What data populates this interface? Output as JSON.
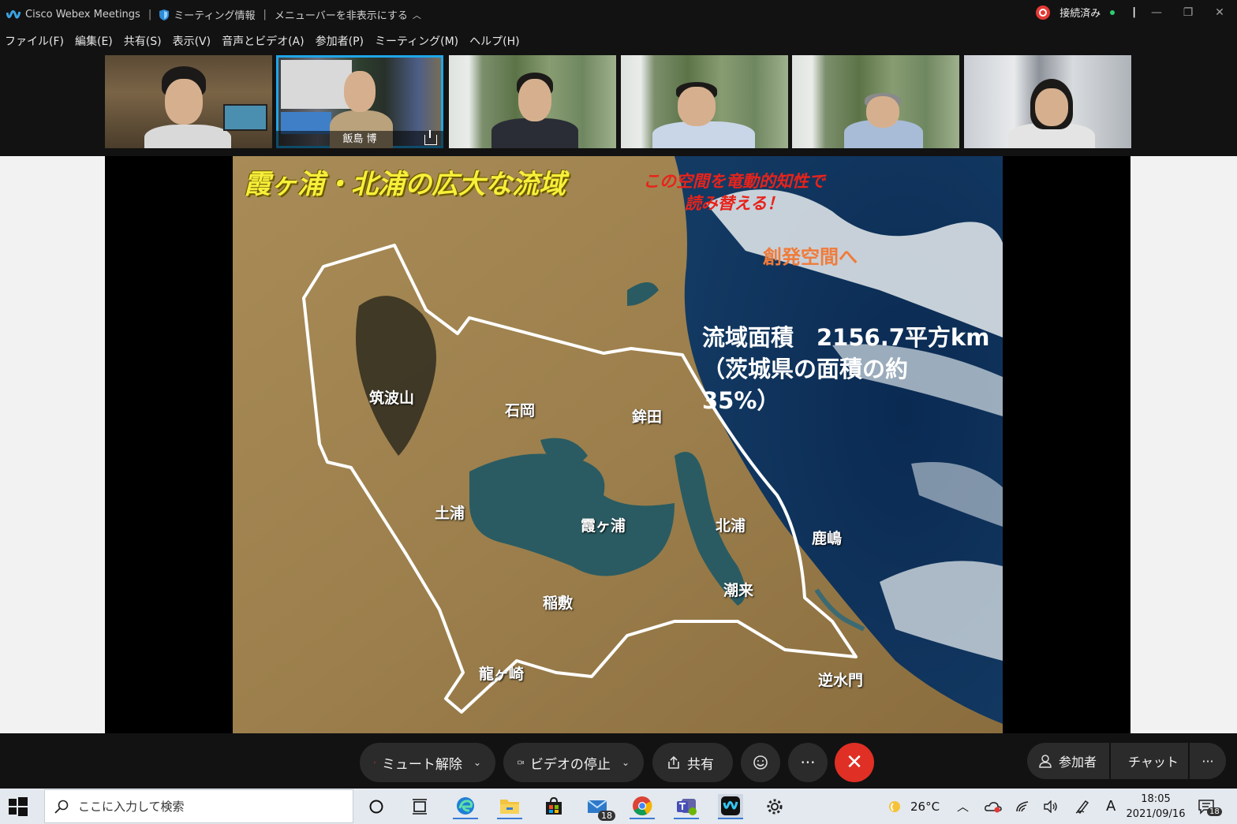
{
  "titlebar": {
    "app_name": "Cisco Webex Meetings",
    "meeting_info": "ミーティング情報",
    "hide_menu": "メニューバーを非表示にする",
    "status": "接続済み"
  },
  "menu": [
    "ファイル(F)",
    "編集(E)",
    "共有(S)",
    "表示(V)",
    "音声とビデオ(A)",
    "参加者(P)",
    "ミーティング(M)",
    "ヘルプ(H)"
  ],
  "participants": [
    {
      "name": "",
      "bg": "room"
    },
    {
      "name": "飯島  博",
      "bg": "study",
      "active": true
    },
    {
      "name": "",
      "bg": "forest"
    },
    {
      "name": "",
      "bg": "forest"
    },
    {
      "name": "",
      "bg": "forest"
    },
    {
      "name": "",
      "bg": "blur"
    }
  ],
  "slide": {
    "title": "霞ヶ浦・北浦の広大な流域",
    "subtitle": "この空間を竜動的知性で\n読み替える！",
    "creation": "創発空間へ",
    "area_text": "流域面積　2156.7平方km\n（茨城県の面積の約\n35%）",
    "places": {
      "tsukuba": "筑波山",
      "ishioka": "石岡",
      "hokota": "鉾田",
      "tsuchiura": "土浦",
      "kasumigaura": "霞ヶ浦",
      "kitaura": "北浦",
      "kashima": "鹿嶋",
      "itako": "潮来",
      "inashiki": "稲敷",
      "ryugasaki": "龍ヶ崎",
      "gyakusuimon": "逆水門"
    }
  },
  "controls": {
    "unmute": "ミュート解除",
    "stop_video": "ビデオの停止",
    "share": "共有",
    "participants": "参加者",
    "chat": "チャット"
  },
  "taskbar": {
    "search_placeholder": "ここに入力して検索",
    "mail_badge": "18",
    "weather": "26°C",
    "ime": "A",
    "time": "18:05",
    "date": "2021/09/16",
    "notif_badge": "18"
  },
  "colors": {
    "accent_active": "#20a6e8",
    "end_call": "#e02f25",
    "slide_title": "#f7ef3a",
    "slide_subtitle": "#e8231b",
    "creation": "#f07b3a"
  }
}
